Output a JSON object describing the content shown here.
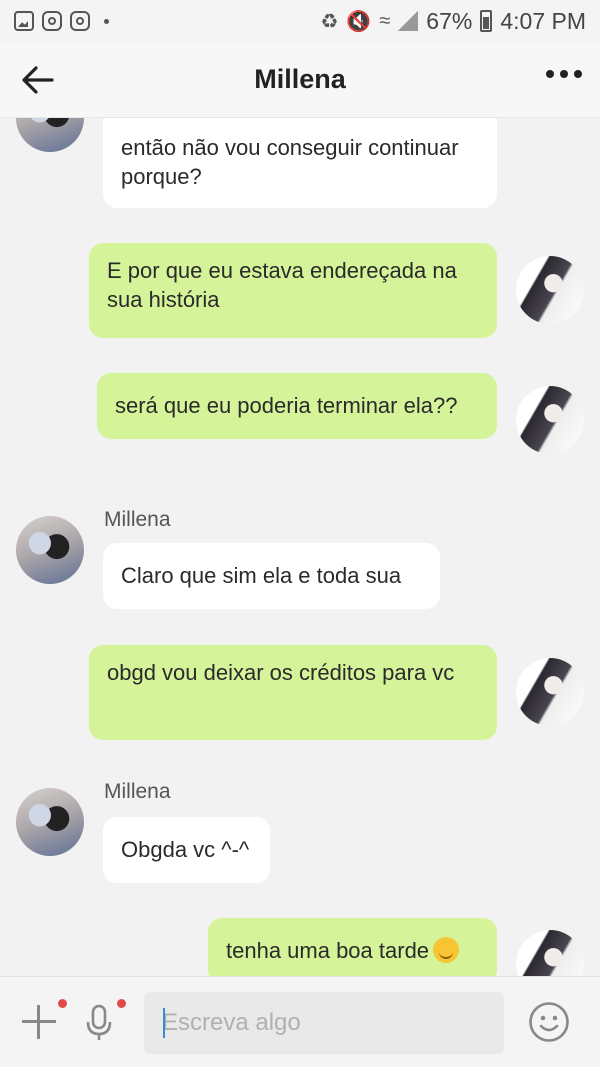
{
  "status_bar": {
    "battery": "67%",
    "time": "4:07 PM"
  },
  "header": {
    "title": "Millena"
  },
  "messages": [
    {
      "direction": "in",
      "text": "então não vou conseguir continuar porque?"
    },
    {
      "direction": "out",
      "text": "E por que eu estava endereçada na sua história"
    },
    {
      "direction": "out",
      "text": "será que eu poderia terminar ela??"
    },
    {
      "direction": "in",
      "sender": "Millena",
      "text": "Claro que sim ela e toda sua"
    },
    {
      "direction": "out",
      "text": "obgd vou deixar os créditos para vc"
    },
    {
      "direction": "in",
      "sender": "Millena",
      "text": "Obgda vc ^-^"
    },
    {
      "direction": "out",
      "text": "tenha uma boa tarde",
      "emoji": "smiling-face"
    }
  ],
  "composer": {
    "placeholder": "Escreva algo"
  },
  "colors": {
    "outgoing_bubble": "#d5f49a",
    "incoming_bubble": "#ffffff",
    "background": "#f2f2f2",
    "notification_dot": "#e24a4a"
  }
}
